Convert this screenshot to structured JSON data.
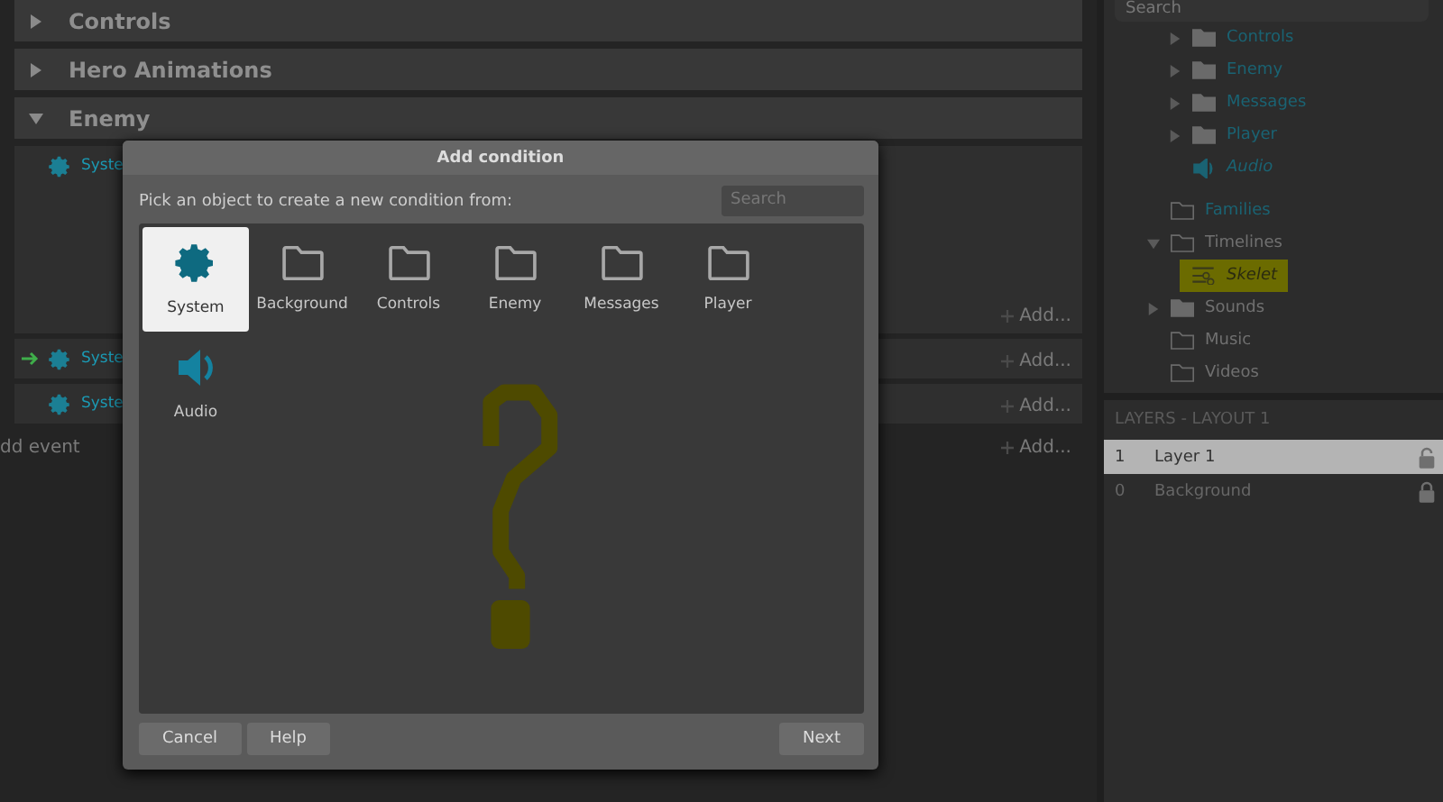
{
  "event_sheet": {
    "groups": [
      {
        "title": "Controls",
        "expanded": false
      },
      {
        "title": "Hero Animations",
        "expanded": false
      },
      {
        "title": "Enemy",
        "expanded": true
      }
    ],
    "events": [
      {
        "label": "Syste",
        "has_arrow": false,
        "add": "Add...",
        "tall": true
      },
      {
        "label": "Syste",
        "has_arrow": true,
        "add": "Add...",
        "tall": false
      },
      {
        "label": "Syste",
        "has_arrow": false,
        "add": "Add...",
        "tall": false
      }
    ],
    "add_event": "dd event",
    "add_event_right": "Add..."
  },
  "project": {
    "search": {
      "placeholder": "Search"
    },
    "object_types": [
      {
        "label": "Controls",
        "kind": "object-folder",
        "expanded": false
      },
      {
        "label": "Enemy",
        "kind": "object-folder",
        "expanded": false
      },
      {
        "label": "Messages",
        "kind": "object-folder",
        "expanded": false
      },
      {
        "label": "Player",
        "kind": "object-folder",
        "expanded": false
      },
      {
        "label": "Audio",
        "kind": "audio"
      }
    ],
    "items": [
      {
        "label": "Families",
        "kind": "family"
      },
      {
        "label": "Timelines",
        "kind": "folder",
        "expanded": true,
        "children": [
          {
            "label": "Skelet",
            "kind": "timeline",
            "highlighted": true
          }
        ]
      },
      {
        "label": "Sounds",
        "kind": "filled-folder",
        "expanded": false
      },
      {
        "label": "Music",
        "kind": "folder"
      },
      {
        "label": "Videos",
        "kind": "folder"
      }
    ]
  },
  "layers": {
    "title": "LAYERS - LAYOUT 1",
    "rows": [
      {
        "index": "1",
        "name": "Layer 1",
        "selected": true,
        "locked": false
      },
      {
        "index": "0",
        "name": "Background",
        "selected": false,
        "locked": true
      }
    ]
  },
  "dialog": {
    "title": "Add condition",
    "prompt": "Pick an object to create a new condition from:",
    "search": {
      "placeholder": "Search"
    },
    "objects": [
      {
        "label": "System",
        "kind": "system",
        "selected": true
      },
      {
        "label": "Background",
        "kind": "folder",
        "selected": false
      },
      {
        "label": "Controls",
        "kind": "folder",
        "selected": false
      },
      {
        "label": "Enemy",
        "kind": "folder",
        "selected": false
      },
      {
        "label": "Messages",
        "kind": "folder",
        "selected": false
      },
      {
        "label": "Player",
        "kind": "folder",
        "selected": false
      },
      {
        "label": "Audio",
        "kind": "audio",
        "selected": false
      }
    ],
    "buttons_left": [
      "Cancel",
      "Help"
    ],
    "button_right": "Next"
  }
}
